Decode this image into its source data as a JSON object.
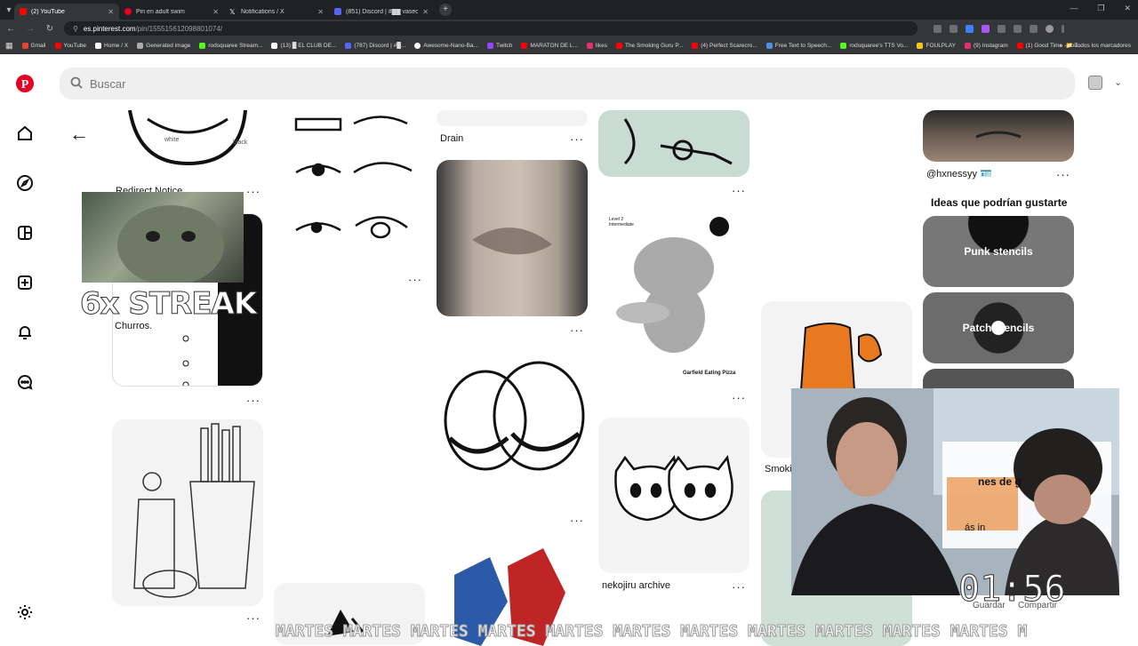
{
  "browser": {
    "tabs": [
      {
        "title": "(2) YouTube",
        "color": "#ff0000"
      },
      {
        "title": "Pin en adult swim",
        "color": "#e60023"
      },
      {
        "title": "Notifications / X",
        "color": "#ffffff"
      },
      {
        "title": "(851) Discord | #██ vaseos-ox...",
        "color": "#5865f2"
      }
    ],
    "url_host": "es.pinterest.com",
    "url_path": "/pin/155515612098801074/",
    "bookmarks": [
      {
        "label": "Gmail",
        "color": "#ea4335"
      },
      {
        "label": "YouTube",
        "color": "#ff0000"
      },
      {
        "label": "Home / X",
        "color": "#ffffff"
      },
      {
        "label": "Generated image",
        "color": "#aaaaaa"
      },
      {
        "label": "rodsquaree Stream...",
        "color": "#53fc18"
      },
      {
        "label": "(13) █ EL CLUB DE...",
        "color": "#ffffff"
      },
      {
        "label": "(787) Discord | #█...",
        "color": "#5865f2"
      },
      {
        "label": "Awesome-Nano-Ba...",
        "color": "#ffffff"
      },
      {
        "label": "Twitch",
        "color": "#9146ff"
      },
      {
        "label": "MARATON DE L...",
        "color": "#ff0000"
      },
      {
        "label": "likes",
        "color": "#e1306c"
      },
      {
        "label": "The Smoking Guru P...",
        "color": "#ff0000"
      },
      {
        "label": "(4) Perfect Scarecro...",
        "color": "#ff0000"
      },
      {
        "label": "Free Text to Speech...",
        "color": "#4a90e2"
      },
      {
        "label": "rodsquaree's TTS Vo...",
        "color": "#53fc18"
      },
      {
        "label": "FOULPLAY",
        "color": "#f5c518"
      },
      {
        "label": "(9) Instagram",
        "color": "#e1306c"
      },
      {
        "label": "(1) Good Time - You...",
        "color": "#ff0000"
      }
    ],
    "all_bookmarks": "Todos los marcadores"
  },
  "pinterest": {
    "search_placeholder": "Buscar",
    "brand_color": "#e60023",
    "sidebar_icons": [
      "home-icon",
      "explore-icon",
      "boards-icon",
      "create-icon",
      "notifications-icon",
      "messages-icon",
      "settings-icon"
    ],
    "captions": {
      "redirect": "Redirect Notice",
      "churros": "Churros.",
      "drain": "Drain",
      "nekojiru": "nekojiru archive",
      "hxnessyy": "@hxnessyy 🪪",
      "smoki": "Smoki",
      "white": "white",
      "black": "black",
      "garfield": "Garfield Eating Pizza",
      "level": "Level 2 Intermediate"
    },
    "ideas_heading": "Ideas que podrían gustarte",
    "ideas": [
      {
        "label": "Punk stencils"
      },
      {
        "label": "Patch stencils"
      }
    ],
    "overlay_fragments": {
      "ideas_fragment": "nes de g",
      "more_fragment": "ás in",
      "save": "Guardar",
      "share": "Compartir"
    }
  },
  "stream_overlay": {
    "streak": "6x STREAK",
    "timer": "01:56",
    "marquee": "MARTES MARTES MARTES MARTES MARTES MARTES MARTES MARTES MARTES MARTES MARTES M"
  }
}
